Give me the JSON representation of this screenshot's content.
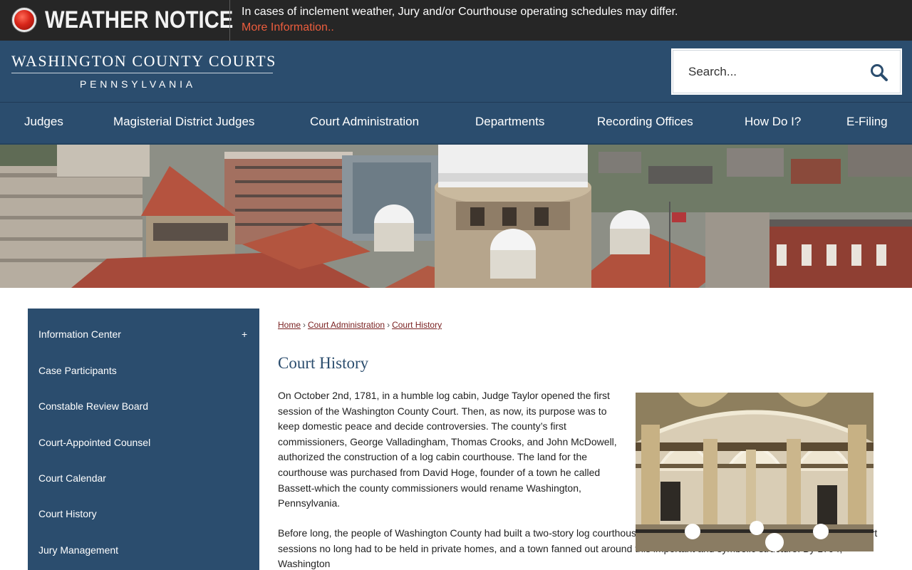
{
  "notice": {
    "title": "WEATHER NOTICE",
    "message": "In cases of inclement weather, Jury and/or Courthouse operating schedules may differ.",
    "link": "More Information.."
  },
  "header": {
    "logo_main": "WASHINGTON COUNTY COURTS",
    "logo_sub": "PENNSYLVANIA",
    "search_placeholder": "Search..."
  },
  "nav": {
    "items": [
      "Judges",
      "Magisterial District Judges",
      "Court Administration",
      "Departments",
      "Recording Offices",
      "How Do I?",
      "E-Filing"
    ]
  },
  "sidebar": {
    "items": [
      "Information Center",
      "Case Participants",
      "Constable Review Board",
      "Court-Appointed Counsel",
      "Court Calendar",
      "Court History",
      "Jury Management"
    ],
    "expand_symbol": "+"
  },
  "breadcrumb": {
    "home": "Home",
    "section": "Court Administration",
    "current": "Court History",
    "separator": "›"
  },
  "page": {
    "title": "Court History",
    "paragraph1": "On October 2nd, 1781, in a humble log cabin, Judge Taylor opened the first session of the Washington County Court. Then, as now, its purpose was to keep domestic peace and decide controversies. The county’s first commissioners, George Valladingham, Thomas Crooks, and John McDowell, authorized the construction of a log cabin courthouse. The land for the courthouse was purchased from David Hoge, founder of a town he called Bassett-which the county commissioners would rename Washington, Pennsylvania.",
    "paragraph2": "Before long, the people of Washington County had built a two-story log courthouse at the summit of one of the area’s highest hills. Court sessions no long had to be held in private homes, and a town fanned out around this important and symbolic structure. By 1794, Washington"
  },
  "colors": {
    "brand_navy": "#2b4d6e",
    "notice_bg": "#262626",
    "notice_link": "#ec5d3d",
    "breadcrumb_link": "#7a2222"
  },
  "icons": {
    "notice": "alert-dot-icon",
    "search": "search-icon"
  }
}
